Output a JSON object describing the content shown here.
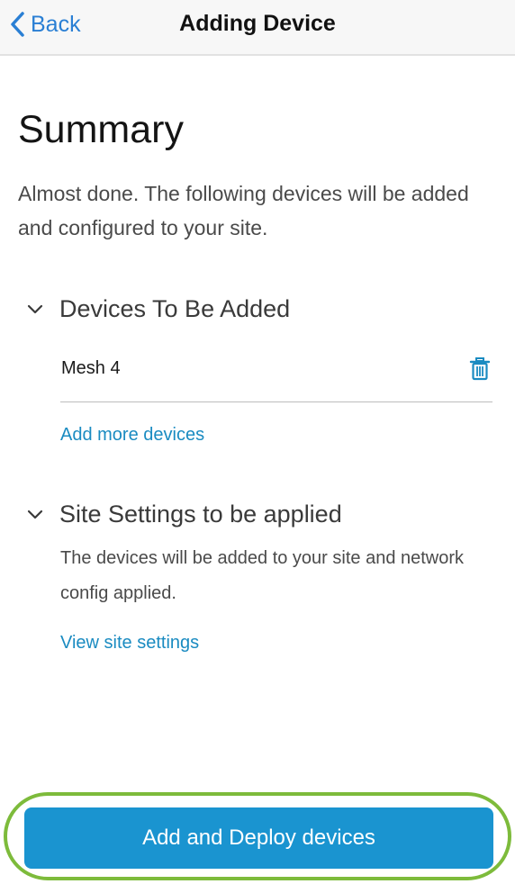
{
  "navbar": {
    "back_label": "Back",
    "title": "Adding Device"
  },
  "summary": {
    "title": "Summary",
    "subtitle": "Almost done. The following devices will be added and configured to your site."
  },
  "devices_section": {
    "header": "Devices To Be Added",
    "devices": [
      {
        "name": "Mesh 4"
      }
    ],
    "add_more_label": "Add more devices"
  },
  "site_section": {
    "header": "Site Settings to be applied",
    "description": "The devices will be added to your site and network config applied.",
    "view_label": "View site settings"
  },
  "deploy_button": {
    "label": "Add and Deploy devices"
  },
  "colors": {
    "accent_blue": "#1a94d0",
    "link_blue": "#1a8bc1",
    "highlight_green": "#7dbb3b"
  }
}
